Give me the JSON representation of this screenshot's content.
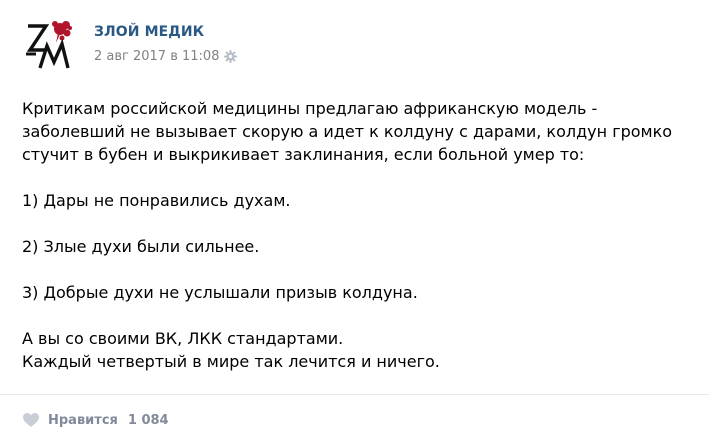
{
  "post": {
    "author": "ЗЛОЙ МЕДИК",
    "date": "2 авг 2017 в 11:08",
    "avatar_icon": "zm-logo-icon",
    "paragraphs": [
      "Критикам российской медицины предлагаю африканскую модель - заболевший не вызывает скорую а идет к колдуну с дарами, колдун громко стучит в бубен и выкрикивает заклинания, если больной умер то:",
      "1) Дары не понравились духам.",
      "2) Злые духи были сильнее.",
      "3) Добрые духи не услышали призыв колдуна.",
      "А вы со своими ВК, ЛКК стандартами.",
      "Каждый четвертый в мире так лечится и ничего."
    ],
    "like_label": "Нравится",
    "like_count": "1 084"
  },
  "colors": {
    "author": "#2a5885",
    "meta": "#828282",
    "like": "#828a99",
    "logo_red": "#b0142a"
  }
}
